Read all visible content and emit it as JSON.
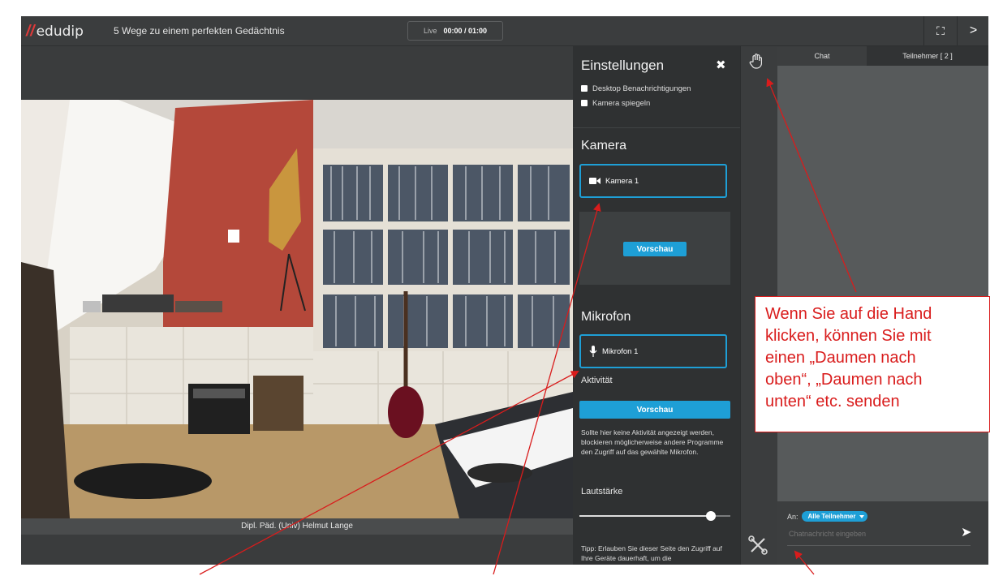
{
  "topbar": {
    "brand": "edudip",
    "title": "5 Wege zu einem perfekten Gedächtnis",
    "live_label": "Live",
    "time": "00:00 / 01:00",
    "expand_glyph": "⛶",
    "next_glyph": ">"
  },
  "video": {
    "caption": "Dipl. Päd. (Univ) Helmut Lange"
  },
  "settings": {
    "title": "Einstellungen",
    "close_glyph": "✖",
    "checkboxes": [
      {
        "label": "Desktop Benachrichtigungen"
      },
      {
        "label": "Kamera spiegeln"
      }
    ],
    "camera": {
      "heading": "Kamera",
      "device": "Kamera 1",
      "preview_button": "Vorschau"
    },
    "microphone": {
      "heading": "Mikrofon",
      "device": "Mikrofon 1",
      "activity_label": "Aktivität",
      "preview_button": "Vorschau",
      "hint": "Sollte hier keine Aktivität angezeigt werden, blockieren möglicherweise andere Programme den Zugriff auf das gewählte Mikrofon.",
      "volume_label": "Lautstärke",
      "volume_level": 0.87,
      "tip": "Tipp: Erlauben Sie dieser Seite den Zugriff auf Ihre Geräte dauerhaft, um die"
    }
  },
  "chat": {
    "tabs": [
      {
        "label": "Chat"
      },
      {
        "label": "Teilnehmer [ 2 ]"
      }
    ],
    "to_label": "An:",
    "recipient": "Alle Teilnehmer",
    "placeholder": "Chatnachricht eingeben",
    "send_glyph": "➤"
  },
  "annotation": {
    "lines": [
      "Wenn Sie auf die Hand",
      "klicken, können Sie mit",
      "einen „Daumen nach",
      "oben“, „Daumen nach",
      "unten“ etc. senden"
    ]
  },
  "colors": {
    "accent": "#1e9fd6",
    "annotation": "#d91c1c",
    "brand": "#e03a3a"
  }
}
